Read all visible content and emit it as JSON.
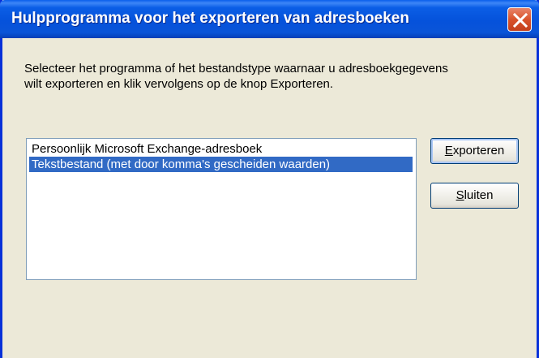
{
  "window": {
    "title": "Hulpprogramma voor het exporteren van adresboeken"
  },
  "description": {
    "line1": "Selecteer het programma of het bestandstype waarnaar u adresboekgegevens",
    "line2": "wilt exporteren en klik vervolgens op de knop Exporteren."
  },
  "list": {
    "items": [
      {
        "label": "Persoonlijk Microsoft Exchange-adresboek",
        "selected": false
      },
      {
        "label": "Tekstbestand (met door komma's gescheiden waarden)",
        "selected": true
      }
    ]
  },
  "buttons": {
    "export": {
      "accel": "E",
      "rest": "xporteren"
    },
    "close": {
      "accel": "S",
      "rest": "luiten"
    }
  },
  "colors": {
    "titlebar": "#0552DB",
    "selection": "#316AC5",
    "close_button": "#D9522B",
    "dialog_background": "#ECE9D8"
  }
}
